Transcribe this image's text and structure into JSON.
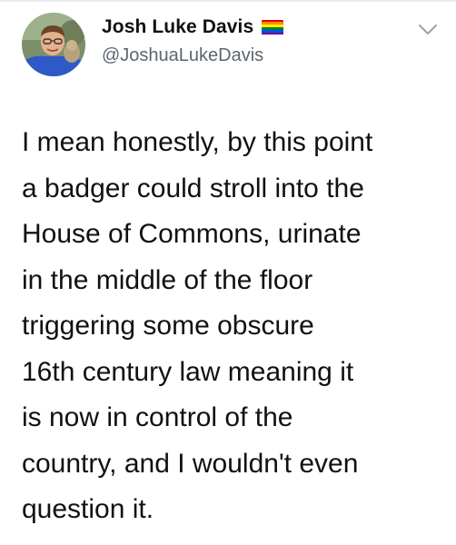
{
  "tweet": {
    "author": {
      "display_name": "Josh Luke Davis",
      "handle": "@JoshuaLukeDavis",
      "badge_icon": "rainbow-flag-icon",
      "badge_colors": [
        "#e40303",
        "#ff8c00",
        "#ffed00",
        "#008026",
        "#004dff",
        "#750787"
      ],
      "avatar_icon": "profile-photo"
    },
    "menu_icon": "chevron-down-icon",
    "text_lines": [
      "I mean honestly, by this point",
      "a badger could stroll into the",
      "House of Commons, urinate",
      "in the middle of the floor",
      "triggering some obscure",
      "16th century law meaning it",
      "is now in control of the",
      "country, and I wouldn't even",
      "question it."
    ]
  }
}
